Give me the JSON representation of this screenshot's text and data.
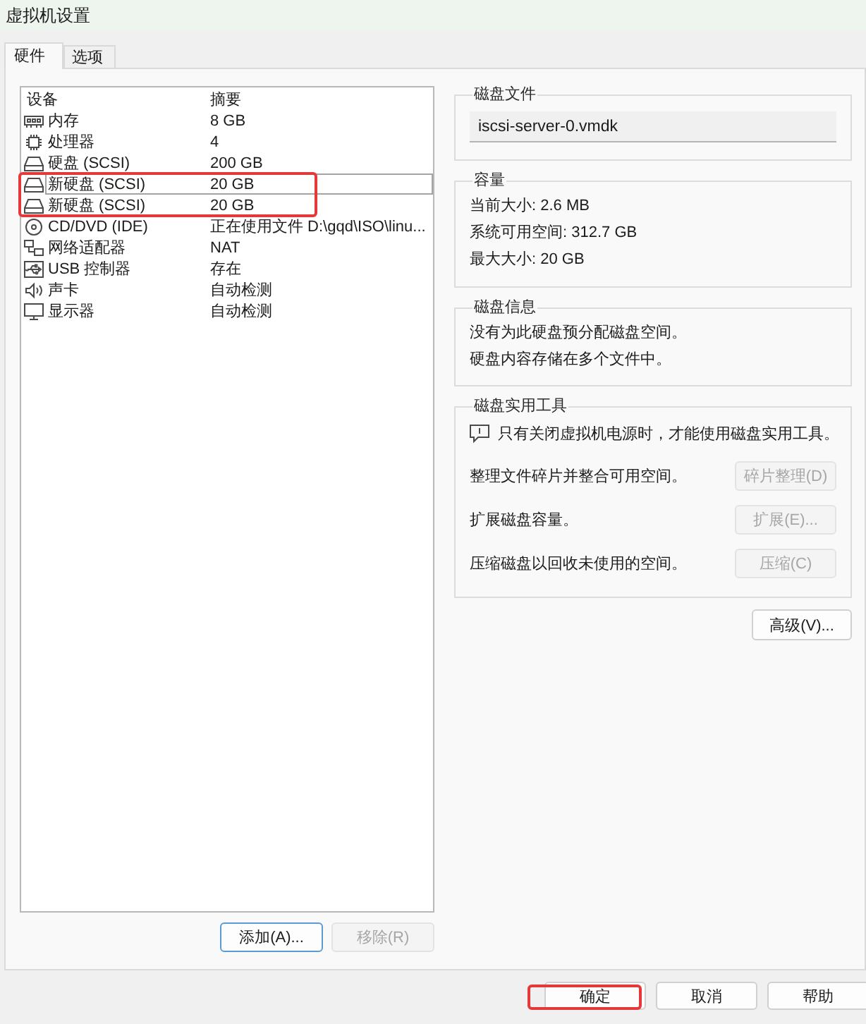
{
  "window": {
    "title": "虚拟机设置"
  },
  "tabs": [
    {
      "label": "硬件",
      "selected": true
    },
    {
      "label": "选项",
      "selected": false
    }
  ],
  "device_list": {
    "columns": [
      "设备",
      "摘要"
    ],
    "rows": [
      {
        "kind": "memory",
        "device": "内存",
        "summary": "8 GB",
        "selected": false,
        "highlighted": false
      },
      {
        "kind": "processor",
        "device": "处理器",
        "summary": "4",
        "selected": false,
        "highlighted": false
      },
      {
        "kind": "disk",
        "device": "硬盘 (SCSI)",
        "summary": "200 GB",
        "selected": false,
        "highlighted": false
      },
      {
        "kind": "disk",
        "device": "新硬盘 (SCSI)",
        "summary": "20 GB",
        "selected": true,
        "highlighted": true
      },
      {
        "kind": "disk",
        "device": "新硬盘 (SCSI)",
        "summary": "20 GB",
        "selected": false,
        "highlighted": true
      },
      {
        "kind": "cdrom",
        "device": "CD/DVD (IDE)",
        "summary": "正在使用文件 D:\\gqd\\ISO\\linu...",
        "selected": false,
        "highlighted": false
      },
      {
        "kind": "network",
        "device": "网络适配器",
        "summary": "NAT",
        "selected": false,
        "highlighted": false
      },
      {
        "kind": "usb",
        "device": "USB 控制器",
        "summary": "存在",
        "selected": false,
        "highlighted": false
      },
      {
        "kind": "sound",
        "device": "声卡",
        "summary": "自动检测",
        "selected": false,
        "highlighted": false
      },
      {
        "kind": "display",
        "device": "显示器",
        "summary": "自动检测",
        "selected": false,
        "highlighted": false
      }
    ],
    "buttons": [
      {
        "label": "添加(A)...",
        "disabled": false,
        "focused": true
      },
      {
        "label": "移除(R)",
        "disabled": true,
        "focused": false
      }
    ]
  },
  "disk_file": {
    "title": "磁盘文件",
    "value": "iscsi-server-0.vmdk"
  },
  "capacity": {
    "title": "容量",
    "lines": [
      "当前大小: 2.6 MB",
      "系统可用空间: 312.7 GB",
      "最大大小: 20 GB"
    ]
  },
  "disk_info": {
    "title": "磁盘信息",
    "lines": [
      "没有为此硬盘预分配磁盘空间。",
      "硬盘内容存储在多个文件中。"
    ]
  },
  "disk_utilities": {
    "title": "磁盘实用工具",
    "notice": "只有关闭虚拟机电源时，才能使用磁盘实用工具。",
    "actions": [
      {
        "description": "整理文件碎片并整合可用空间。",
        "button": "碎片整理(D)",
        "disabled": true
      },
      {
        "description": "扩展磁盘容量。",
        "button": "扩展(E)...",
        "disabled": true
      },
      {
        "description": "压缩磁盘以回收未使用的空间。",
        "button": "压缩(C)",
        "disabled": true
      }
    ]
  },
  "advanced_button": "高级(V)...",
  "dialog_buttons": [
    {
      "label": "确定",
      "highlighted": true
    },
    {
      "label": "取消",
      "highlighted": false
    },
    {
      "label": "帮助",
      "highlighted": false
    }
  ]
}
